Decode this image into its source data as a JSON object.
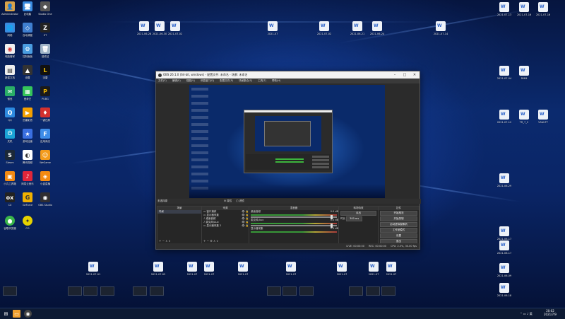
{
  "obs": {
    "title": "OBS 26.1.0 (64-bit, windows) - 配置文件: 未命名 - 场景: 未命名",
    "menu": [
      "文件(F)",
      "编辑(E)",
      "视图(V)",
      "停靠窗口(D)",
      "配置文件(P)",
      "场景集合(S)",
      "工具(T)",
      "帮助(H)"
    ],
    "scene_bar_label": "未选择源",
    "properties_label": "属性",
    "filters_label": "滤镜",
    "docks": {
      "scenes": {
        "header": "场景",
        "items": [
          "场景"
        ]
      },
      "sources": {
        "header": "来源",
        "items": [
          "窗口捕获",
          "显示器采集",
          "桌面音频",
          "麦克风/Aux",
          "显示器采集 2"
        ]
      },
      "mixer": {
        "header": "混音器",
        "channels": [
          {
            "name": "桌面音频",
            "level": "0.0 dB"
          },
          {
            "name": "麦克风/Aux",
            "level": "0.0 dB"
          },
          {
            "name": "显示器采集",
            "level": "0.0 dB"
          }
        ]
      },
      "transitions": {
        "header": "转场特效",
        "type_label": "淡出",
        "duration_label": "时长",
        "duration": "300 ms"
      },
      "controls": {
        "header": "控件",
        "buttons": [
          "开始推流",
          "开始录制",
          "启动虚拟摄像机",
          "工作室模式",
          "设置",
          "退出"
        ]
      }
    },
    "status": [
      "LIVE: 00:00:00",
      "REC: 00:00:00",
      "CPU: 2.3%, 30.00 fps"
    ]
  },
  "desktop": {
    "icons_left": [
      {
        "label": "Administrator",
        "color": "#d8a24a",
        "glyph": "👤"
      },
      {
        "label": "此电脑",
        "color": "#3a8be0",
        "glyph": "🖥"
      },
      {
        "label": "网络",
        "color": "#3a8be0",
        "glyph": "🌐"
      },
      {
        "label": "回收站",
        "color": "#9fb4c8",
        "glyph": "🗑"
      },
      {
        "label": "控制面板",
        "color": "#4a9de0",
        "glyph": "⚙"
      },
      {
        "label": "微信",
        "color": "#2aae67",
        "glyph": "✉"
      },
      {
        "label": "QQ",
        "color": "#2d8ae0",
        "glyph": "Q"
      },
      {
        "label": "Steam",
        "color": "#1b2838",
        "glyph": "S"
      },
      {
        "label": "OBS Studio",
        "color": "#302e31",
        "glyph": "◉"
      },
      {
        "label": "腾讯会议",
        "color": "#2f6bd9",
        "glyph": "M"
      }
    ],
    "taskbar": {
      "time": "20:02",
      "date": "2021/7/9"
    }
  }
}
